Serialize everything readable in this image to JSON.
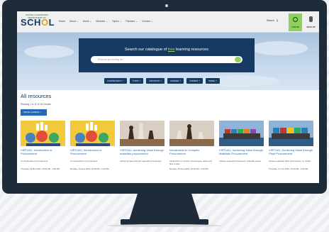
{
  "site": {
    "logo_top": "DIGITAL CLASSROOM DEPARTMENT OF",
    "logo_main_a": "SCH",
    "logo_main_o": "O",
    "logo_main_b": "L"
  },
  "nav": [
    "Home",
    "About ⌄",
    "Users ⌄",
    "Modules ⌄",
    "Topics ⌄",
    "Partners ⌄",
    "Contact ⌄"
  ],
  "header": {
    "search_label": "Search   Q",
    "login_label": "LOG IN",
    "signup_label": "SIGN UP"
  },
  "hero": {
    "title_pre": "Search our catalogue of ",
    "title_free": "free",
    "title_post": " learning resources",
    "placeholder": "What are you looking for?"
  },
  "filters": [
    "COMPETENCY ˅",
    "TOPIC ˅",
    "INDUSTRY ˅",
    "MARKET ˅",
    "FORMAT ˅",
    "MORE ˅"
  ],
  "resources": {
    "title": "All resources",
    "showing": "Showing 1 to 12 of 110 results",
    "sort_label": "PRICE LOWEST ˅"
  },
  "cards": [
    {
      "title": "VIRTUAL: Introduction to Procurement",
      "desc": "An introduction to procurement",
      "date": "Thursday, 23 Mar 2023, 10:00 AM - 1:00 PM",
      "thumb": "illustration"
    },
    {
      "title": "VIRTUAL: Introduction to Procurement",
      "desc": "An introduction to procurement",
      "date": "Monday, 26 June 2023, 10:00 AM - 1:00 PM",
      "thumb": "illustration"
    },
    {
      "title": "VIRTUAL: Achieving Value through materials procurement",
      "desc": "Achieving value through materials procurement",
      "date": "",
      "thumb": "chess"
    },
    {
      "title": "Introduction to Complex Procurement",
      "desc": "Introduction to complex procurement, online and face to face",
      "date": "Monday, 26 June 2023, 10:00 AM - 1:00 PM",
      "thumb": "chess"
    },
    {
      "title": "VIRTUAL: Achieving Value through Materials Procurement",
      "desc": "Achieve material procurement, materials values",
      "date": "",
      "thumb": "ship"
    },
    {
      "title": "VIRTUAL: Achieving Value through Plant Procurement",
      "desc": "Achieve materials plant procurement, on rentals",
      "date": "Thursday, 27 July 2023, 10:00 AM - 1:00 PM",
      "thumb": "ship"
    }
  ],
  "colors": {
    "navy": "#173a63",
    "green": "#8fd15a",
    "link": "#2469b3",
    "bezel": "#1e2b38"
  }
}
